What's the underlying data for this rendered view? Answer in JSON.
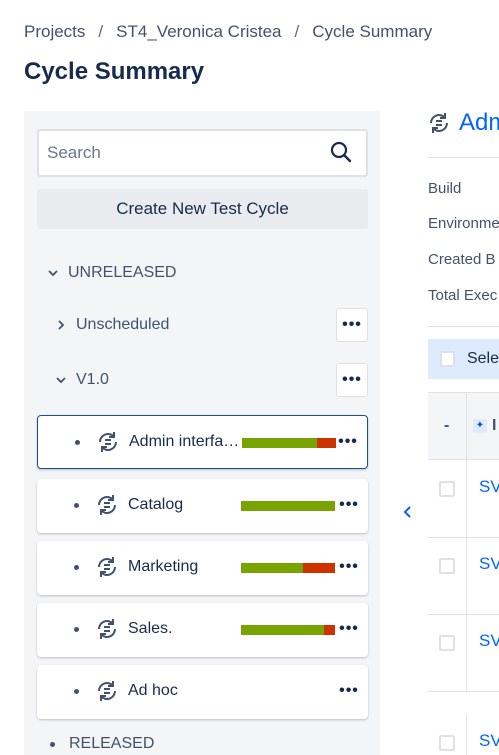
{
  "breadcrumb": [
    "Projects",
    "ST4_Veronica Cristea",
    "Cycle Summary"
  ],
  "page_title": "Cycle Summary",
  "sidebar": {
    "search_placeholder": "Search",
    "create_button": "Create New Test Cycle",
    "unreleased_label": "UNRELEASED",
    "released_label": "RELEASED",
    "folders": [
      {
        "label": "Unscheduled",
        "expanded": false,
        "more": "•••"
      },
      {
        "label": "V1.0",
        "expanded": true,
        "more": "•••"
      }
    ],
    "cycles": [
      {
        "name": "Admin interface",
        "display_name": "Admin interfa…",
        "pass": 0.8,
        "fail": 0.2,
        "selected": true,
        "more": "•••"
      },
      {
        "name": "Catalog",
        "display_name": "Catalog",
        "pass": 1.0,
        "fail": 0.0,
        "selected": false,
        "more": "•••"
      },
      {
        "name": "Marketing",
        "display_name": "Marketing",
        "pass": 0.66,
        "fail": 0.34,
        "selected": false,
        "more": "•••"
      },
      {
        "name": "Sales.",
        "display_name": "Sales.",
        "pass": 0.88,
        "fail": 0.12,
        "selected": false,
        "more": "•••"
      },
      {
        "name": "Ad hoc",
        "display_name": "Ad hoc",
        "pass": 0.0,
        "fail": 0.0,
        "selected": false,
        "more": "•••"
      }
    ]
  },
  "detail": {
    "title": "Adm",
    "fields": [
      "Build",
      "Environme",
      "Created B",
      "Total Exec"
    ],
    "select_label": "Sele",
    "column_dash": "-",
    "column_header": "I",
    "row_keys": [
      "SV",
      "SV",
      "SV",
      "SV"
    ]
  },
  "colors": {
    "pass": "#78a300",
    "fail": "#cc3300",
    "accent": "#0065ff"
  }
}
